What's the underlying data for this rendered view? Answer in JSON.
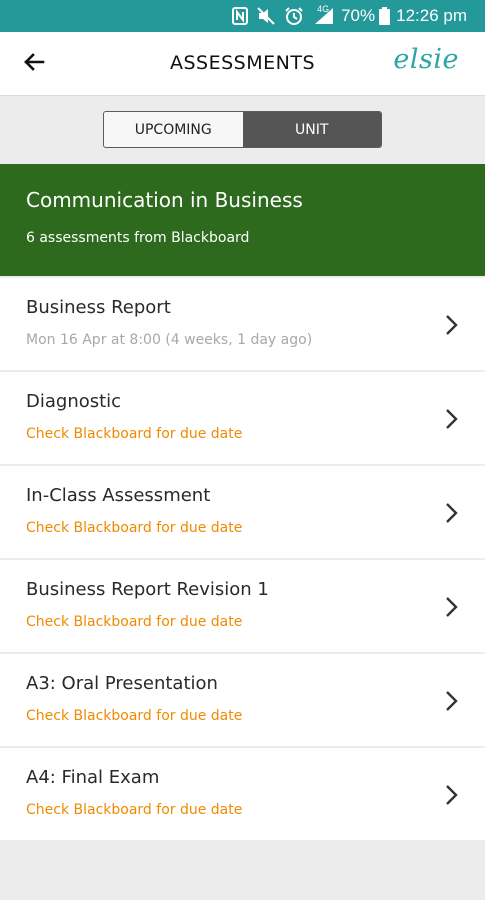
{
  "status_bar": {
    "icons": [
      "nfc-icon",
      "mute-icon",
      "alarm-icon",
      "signal-4g-icon",
      "battery-icon"
    ],
    "network_badge": "4G",
    "battery": "70%",
    "time": "12:26 pm"
  },
  "app_bar": {
    "back_icon": "arrow-left-icon",
    "title": "ASSESSMENTS",
    "logo": "elsie"
  },
  "tabs": [
    {
      "label": "UPCOMING",
      "active": false
    },
    {
      "label": "UNIT",
      "active": true
    }
  ],
  "unit": {
    "name": "Communication in Business",
    "summary": "6 assessments from Blackboard",
    "color": "#2e6a1e"
  },
  "assessments": [
    {
      "title": "Business Report",
      "subtitle": "Mon 16 Apr at 8:00 (4 weeks, 1 day ago)",
      "subtitle_style": "muted"
    },
    {
      "title": "Diagnostic",
      "subtitle": "Check Blackboard for due date",
      "subtitle_style": "warn"
    },
    {
      "title": "In-Class Assessment",
      "subtitle": "Check Blackboard for due date",
      "subtitle_style": "warn"
    },
    {
      "title": "Business Report Revision 1",
      "subtitle": "Check Blackboard for due date",
      "subtitle_style": "warn"
    },
    {
      "title": "A3: Oral Presentation",
      "subtitle": "Check Blackboard for due date",
      "subtitle_style": "warn"
    },
    {
      "title": "A4: Final Exam",
      "subtitle": "Check Blackboard for due date",
      "subtitle_style": "warn"
    }
  ],
  "colors": {
    "status_bar": "#23999a",
    "accent": "#2aa7a3",
    "warning_text": "#f08a00",
    "muted_text": "#a8a8a8"
  }
}
